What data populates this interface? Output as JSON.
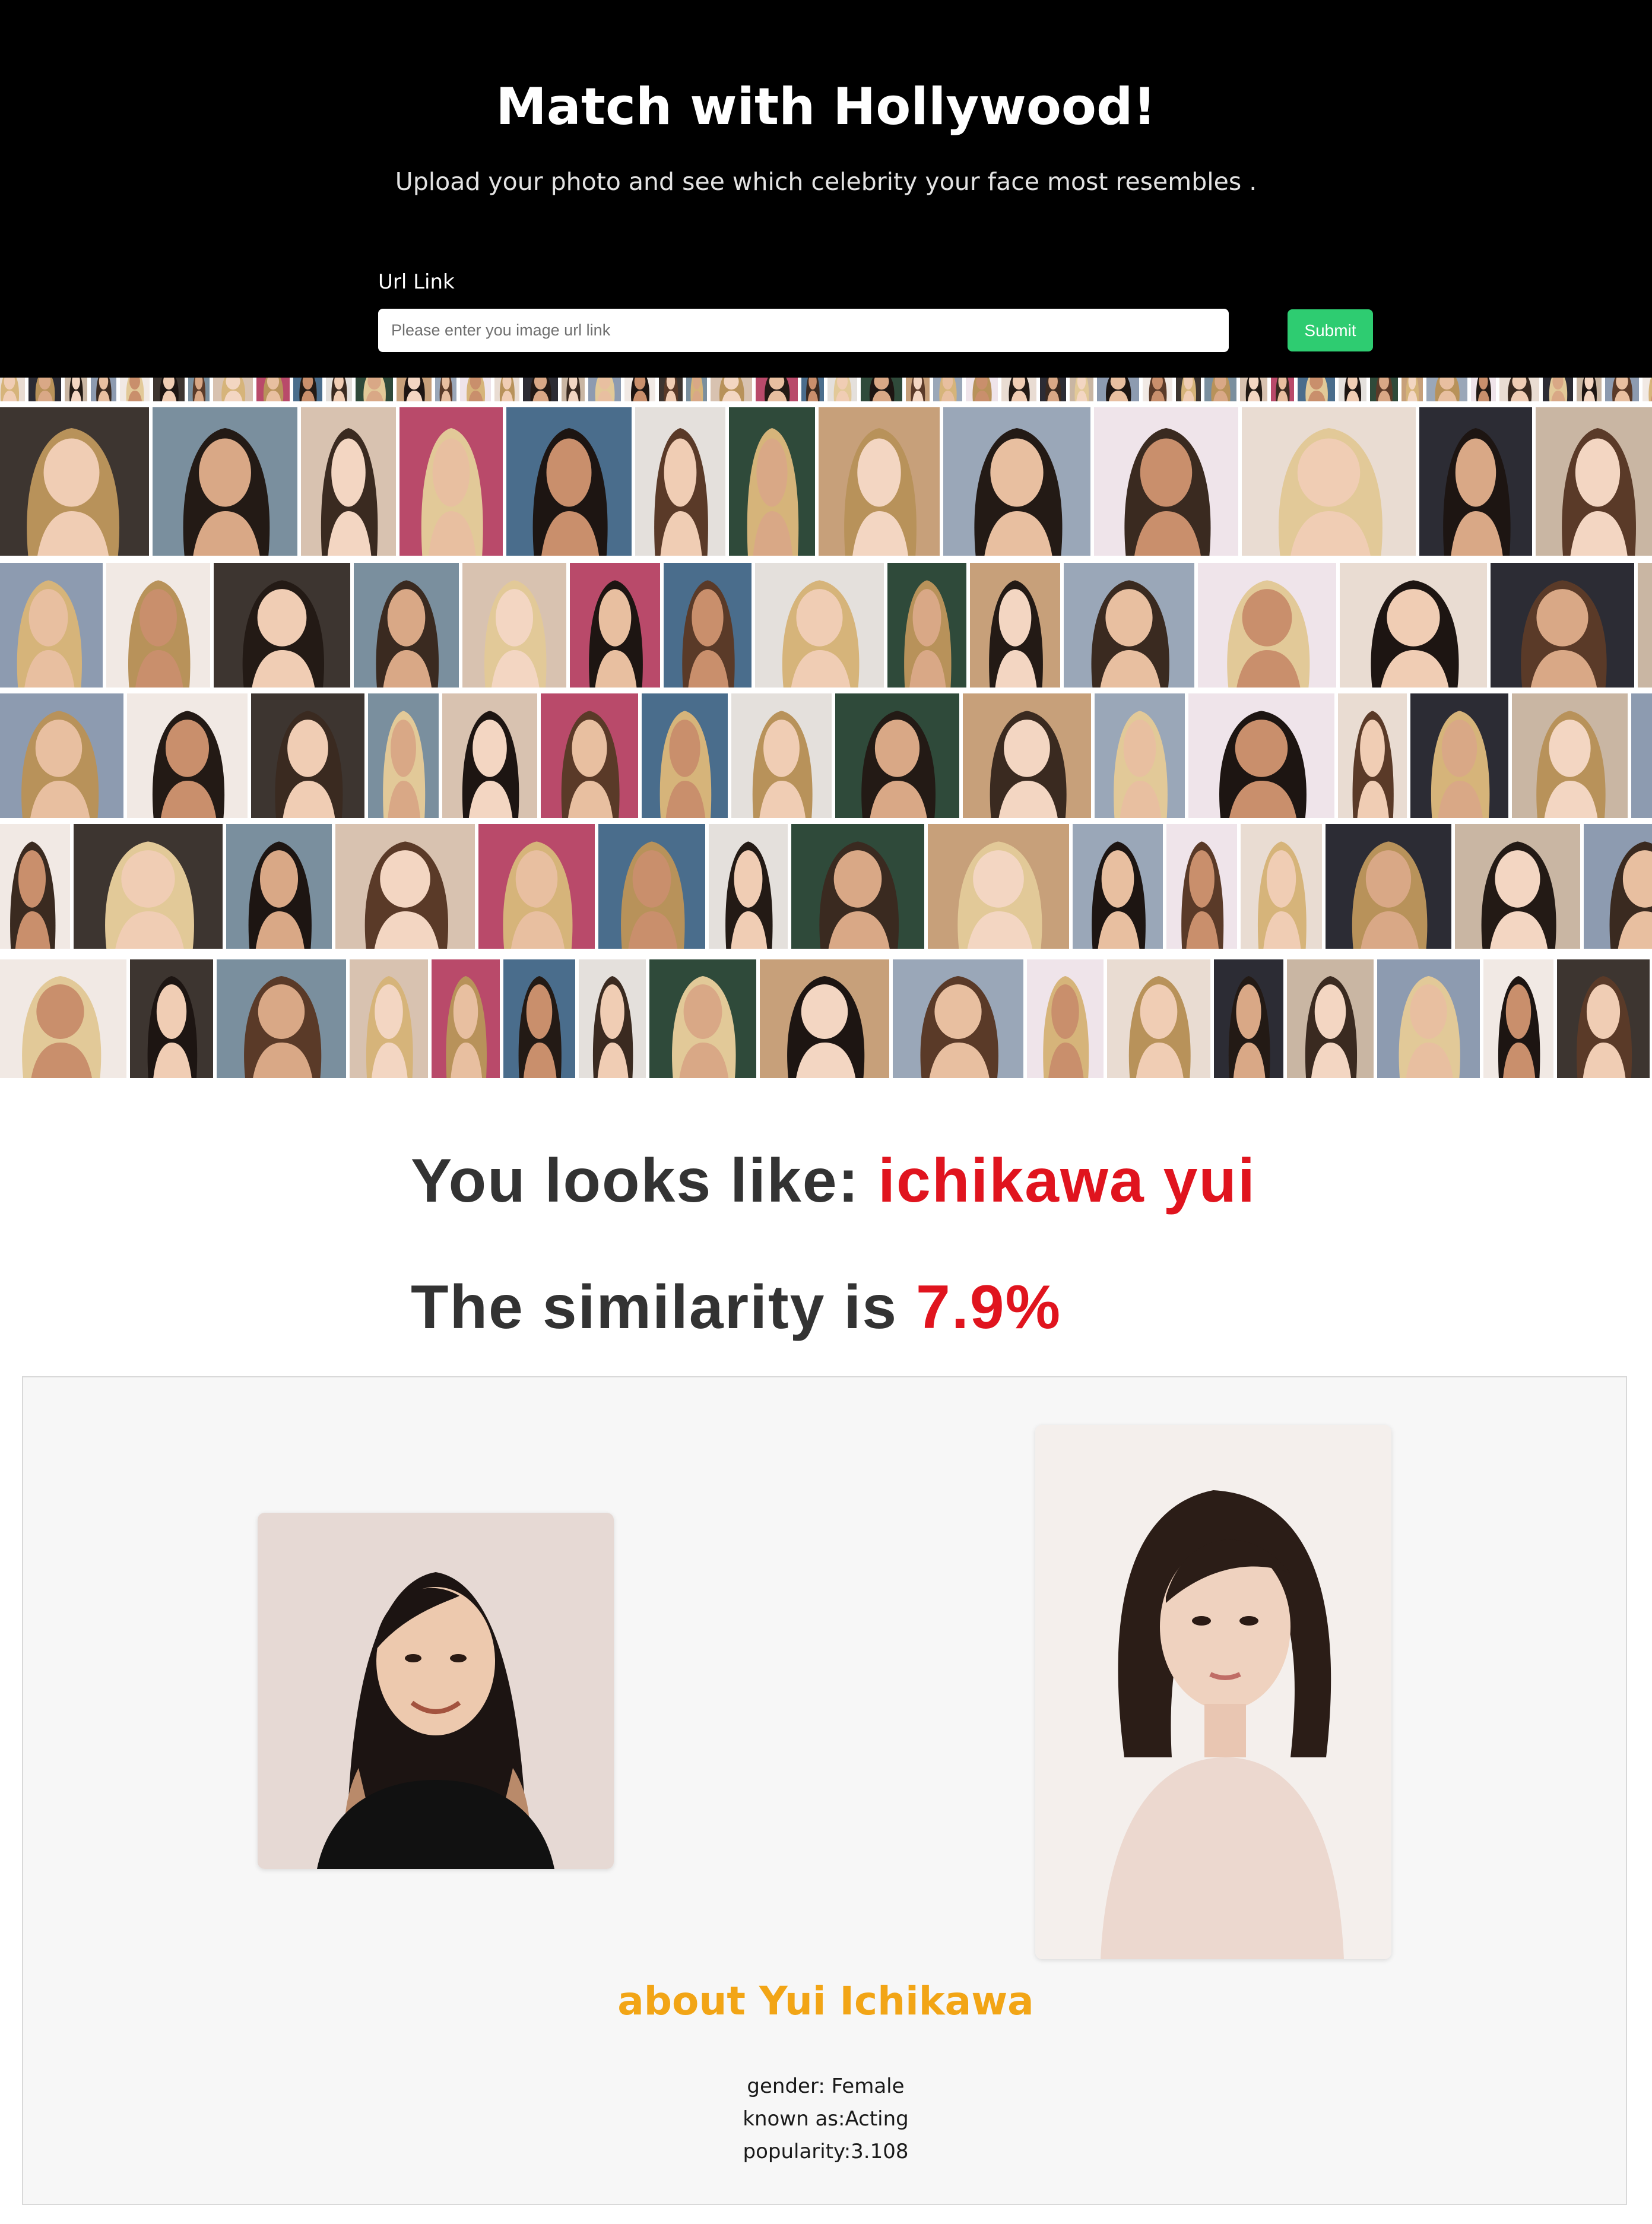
{
  "header": {
    "title": "Match with Hollywood!",
    "subtitle": "Upload your photo and see which celebrity your face most resembles .",
    "url_label": "Url Link",
    "url_placeholder": "Please enter you image url link",
    "submit_label": "Submit"
  },
  "result": {
    "looks_like_prefix": "You looks like: ",
    "match_name": "ichikawa yui",
    "similarity_prefix": "The similarity is ",
    "similarity_value": "7.9%"
  },
  "about": {
    "title": "about Yui Ichikawa",
    "gender": "gender: Female",
    "known_as": "known as:Acting",
    "popularity": "popularity:3.108"
  },
  "colors": {
    "header_bg": "#000000",
    "submit": "#2ecc71",
    "highlight_red": "#e0141e",
    "about_orange": "#f2a516"
  }
}
